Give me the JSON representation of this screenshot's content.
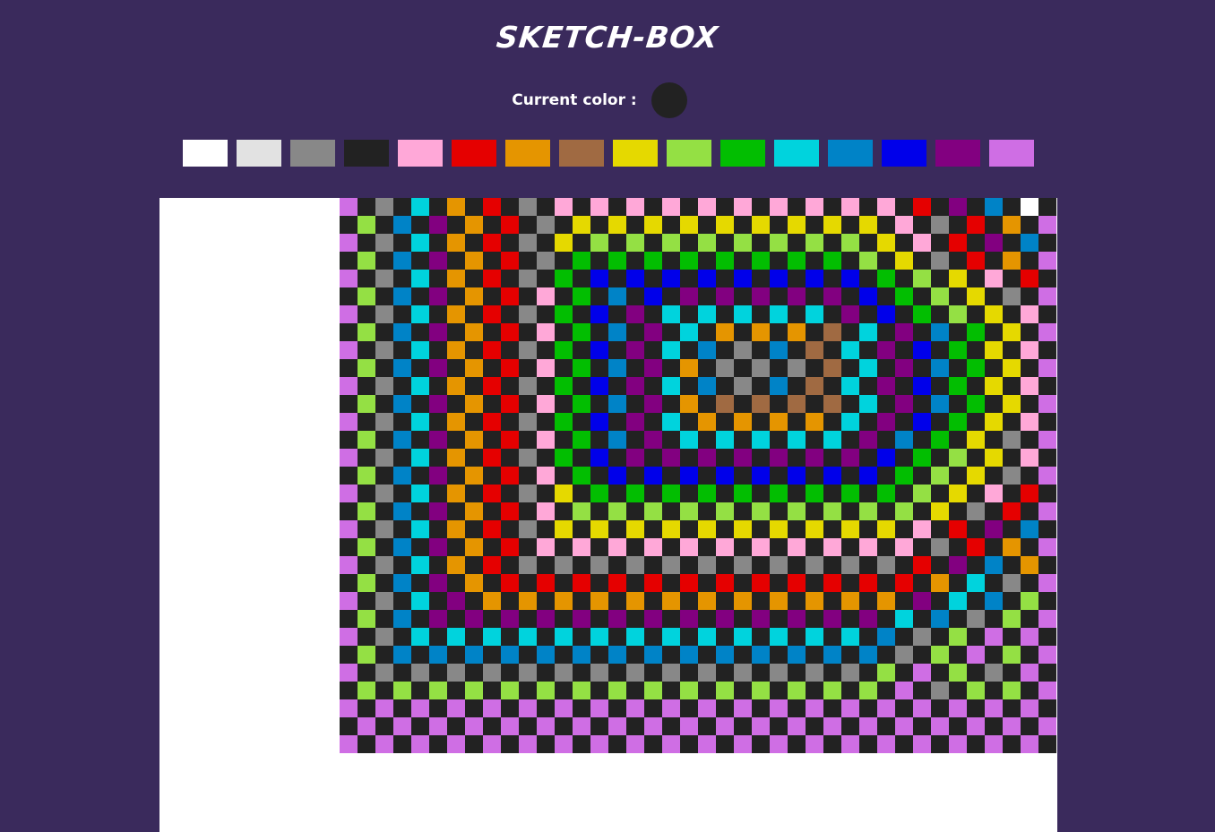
{
  "title": "SKETCH-BOX",
  "current_color": {
    "label": "Current color :",
    "color": "#222222"
  },
  "palette": [
    {
      "name": "white",
      "color": "#ffffff"
    },
    {
      "name": "light-gray",
      "color": "#e2e2e2"
    },
    {
      "name": "gray",
      "color": "#888888"
    },
    {
      "name": "black",
      "color": "#222222"
    },
    {
      "name": "pink",
      "color": "#ffa8d8"
    },
    {
      "name": "red",
      "color": "#e50000"
    },
    {
      "name": "orange",
      "color": "#e59500"
    },
    {
      "name": "brown",
      "color": "#a06a42"
    },
    {
      "name": "yellow",
      "color": "#e5d900"
    },
    {
      "name": "light-green",
      "color": "#94e044"
    },
    {
      "name": "green",
      "color": "#02be01"
    },
    {
      "name": "cyan",
      "color": "#00d3dd"
    },
    {
      "name": "teal-blue",
      "color": "#0083c7"
    },
    {
      "name": "blue",
      "color": "#0000ea"
    },
    {
      "name": "purple",
      "color": "#820080"
    },
    {
      "name": "lilac",
      "color": "#cf6ee4"
    }
  ],
  "canvas": {
    "background": "#ffffff",
    "dark_color": "#222222",
    "rows": [
      "VKGKCKOKRKGKPKPKPKPKPKPKPKPKPKPKRKUKBKTK",
      "KLKBKUKOKRKGKYKYKYKYKYKYKYKYKYKPKGKRKOKV",
      "VKGKCKOKRKGKYKLKLKLKLKLKLKLKLKYKPKRKUKBK",
      "KLKBKUKOKRKGKEKEKEKEKEKEKEKEKLKYKGKRKOKV",
      "VKGKCKOKRKGKEKNKNKNKNKNKNKNKNKEKLKYKPKRK",
      "KLKBKUKOKRKPKEKBKNKUKUKUKUKUKNKEKLKYKGKV",
      "VKGKCKOKRKGKEKNKUKCKCKCKCKCKUKNKEKLKYKPK",
      "KLKBKUKOKRKPKEKBKUKCKOKOKOKWKCKUKBKEKYKV",
      "VKGKCKOKRKGKEKNKUKCKBKGKBKWKCKUKNKEKYKPK",
      "KLKBKUKOKRKPKEKBKUKOKGKGKGKWKCKUKBKEKYKV",
      "VKGKCKOKRKGKEKNKUKCKBKGKBKWKCKUKNKEKYKPK",
      "KLKBKUKOKRKPKEKBKUKOKWKWKWKWKCKUKBKEKYKV",
      "VKGKCKOKRKGKEKNKUKCKOKOKOKOKCKUKNKEKYKPK",
      "KLKBKUKOKRKPKEKBKUKCKCKCKCKCKUKBKEKYKGKV",
      "VKGKCKOKRKGKEKNKUKUKUKUKUKUKUKNKEKLKYKPK",
      "KLKBKUKOKRKPKEKNKNKNKNKNKNKNKNKEKLKYKGKV",
      "VKGKCKOKRKGKYKEKEKEKEKEKEKEKEKEKLKYKPKRK",
      "KLKBKUKOKRKPKLKLKLKLKLKLKLKLKLKLKYKGKRKV",
      "VKGKCKOKRKGKYKYKYKYKYKYKYKYKYKYKPKRKUKBK",
      "KLKBKUKOKRKPKPKPKPKPKPKPKPKPKPKPKGKRKOKV",
      "VKGKCKOKRKGKGKGKGKGKGKGKGKGKGKGKRKUKBKOK",
      "KLKBKUKOKRKRKRKRKRKRKRKRKRKRKRKRKOKCKGKV",
      "VKGKCKUKOKOKOKOKOKOKOKOKOKOKOKOKUKCKBKLK",
      "KLKBKUKUKUKUKUKUKUKUKUKUKUKUKUKCKBKGKLKV",
      "VKGKCKCKCKCKCKCKCKCKCKCKCKCKCKBKGKLKVKVK",
      "KLKBKBKBKBKBKBKBKBKBKBKBKBKBKBKGKLKVKLKV",
      "VKGKGKGKGKGKGKGKGKGKGKGKGKGKGKLKVKLKGKVK",
      "KLKLKLKLKLKLKLKLKLKLKLKLKLKLKLKVKGKLKLKV",
      "VKVKVKVKVKVKVKVKVKVKVKVKVKVKVKVKVKVKVKVK",
      "KVKVKVKVKVKVKVKVKVKVKVKVKVKVKVKVKVKVKVKV",
      "VKVKVKVKVKVKVKVKVKVKVKVKVKVKVKVKVKVKVKVK"
    ],
    "legend": {
      "K": "#222222",
      "V": "#cf6ee4",
      "L": "#94e044",
      "G": "#888888",
      "B": "#0083c7",
      "C": "#00d3dd",
      "U": "#820080",
      "O": "#e59500",
      "R": "#e50000",
      "P": "#ffa8d8",
      "Y": "#e5d900",
      "E": "#02be01",
      "N": "#0000ea",
      "W": "#a06a42"
    }
  }
}
